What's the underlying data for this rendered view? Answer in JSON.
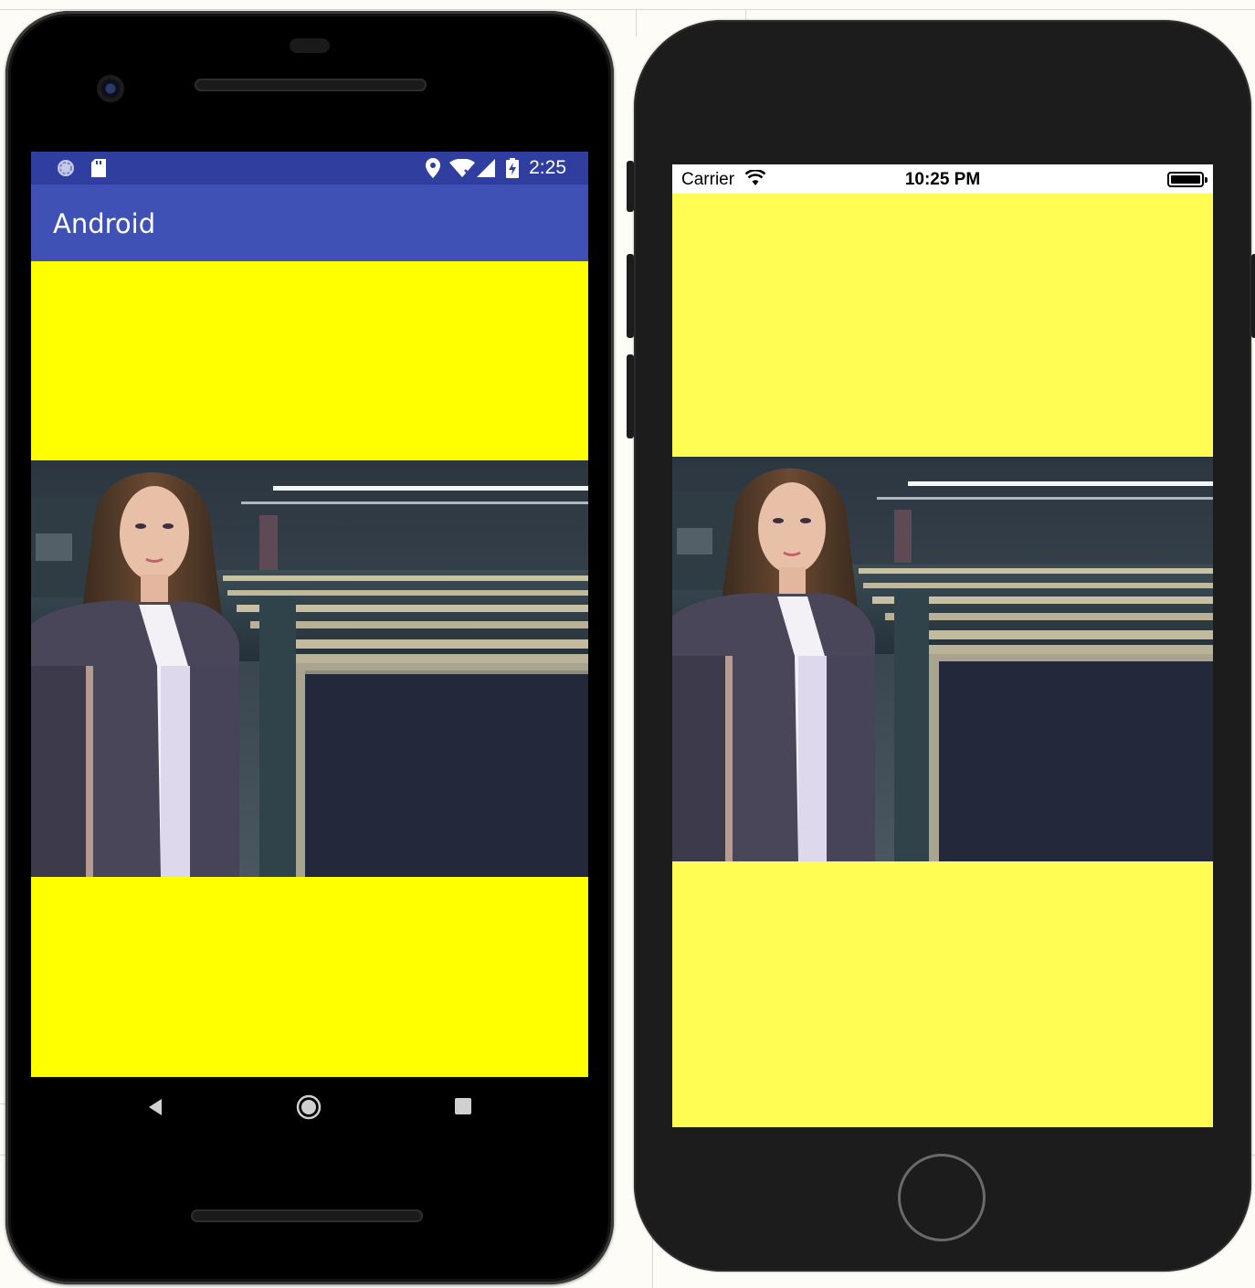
{
  "android": {
    "status_time": "2:25",
    "app_title": "Android",
    "theme_colors": {
      "status_bar": "#303f9f",
      "app_bar": "#3f51b5",
      "content_bg": "#ffff00"
    },
    "status_icons": [
      "pie-icon",
      "sd-card-icon",
      "location-icon",
      "wifi-x-icon",
      "signal-icon",
      "battery-charging-icon"
    ],
    "nav_buttons": [
      "back-icon",
      "home-icon",
      "recents-icon"
    ]
  },
  "ios": {
    "carrier": "Carrier",
    "status_time": "10:25 PM",
    "content_bg": "#fffd54",
    "status_icons": [
      "wifi-icon",
      "battery-icon"
    ]
  }
}
